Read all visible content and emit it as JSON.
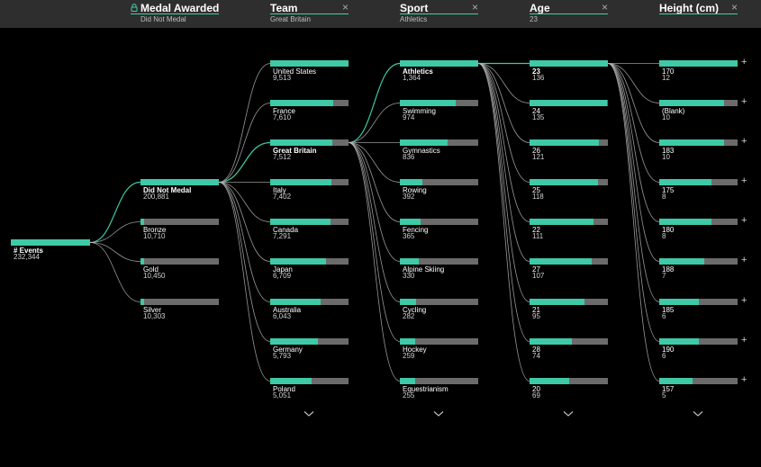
{
  "header": {
    "columns": [
      {
        "title": "Medal Awarded",
        "filter": "Did Not Medal",
        "close": "",
        "locked": true
      },
      {
        "title": "Team",
        "filter": "Great Britain",
        "close": "×",
        "locked": false
      },
      {
        "title": "Sport",
        "filter": "Athletics",
        "close": "×",
        "locked": false
      },
      {
        "title": "Age",
        "filter": "23",
        "close": "×",
        "locked": false
      },
      {
        "title": "Height (cm)",
        "filter": "",
        "close": "×",
        "locked": false
      }
    ]
  },
  "root": {
    "label": "# Events",
    "value": "232,344"
  },
  "levels": [
    {
      "name": "Medal Awarded",
      "nodes": [
        {
          "label": "Did Not Medal",
          "value": "200,881",
          "fill": 1.0,
          "selected": true
        },
        {
          "label": "Bronze",
          "value": "10,710",
          "fill": 0.05,
          "selected": false
        },
        {
          "label": "Gold",
          "value": "10,450",
          "fill": 0.05,
          "selected": false
        },
        {
          "label": "Silver",
          "value": "10,303",
          "fill": 0.05,
          "selected": false
        }
      ]
    },
    {
      "name": "Team",
      "nodes": [
        {
          "label": "United States",
          "value": "9,513",
          "fill": 1.0,
          "selected": false
        },
        {
          "label": "France",
          "value": "7,610",
          "fill": 0.8,
          "selected": false
        },
        {
          "label": "Great Britain",
          "value": "7,512",
          "fill": 0.79,
          "selected": true
        },
        {
          "label": "Italy",
          "value": "7,402",
          "fill": 0.78,
          "selected": false
        },
        {
          "label": "Canada",
          "value": "7,291",
          "fill": 0.77,
          "selected": false
        },
        {
          "label": "Japan",
          "value": "6,709",
          "fill": 0.71,
          "selected": false
        },
        {
          "label": "Australia",
          "value": "6,043",
          "fill": 0.64,
          "selected": false
        },
        {
          "label": "Germany",
          "value": "5,793",
          "fill": 0.61,
          "selected": false
        },
        {
          "label": "Poland",
          "value": "5,051",
          "fill": 0.53,
          "selected": false
        }
      ]
    },
    {
      "name": "Sport",
      "nodes": [
        {
          "label": "Athletics",
          "value": "1,364",
          "fill": 1.0,
          "selected": true
        },
        {
          "label": "Swimming",
          "value": "974",
          "fill": 0.71,
          "selected": false
        },
        {
          "label": "Gymnastics",
          "value": "836",
          "fill": 0.61,
          "selected": false
        },
        {
          "label": "Rowing",
          "value": "392",
          "fill": 0.29,
          "selected": false
        },
        {
          "label": "Fencing",
          "value": "365",
          "fill": 0.27,
          "selected": false
        },
        {
          "label": "Alpine Skiing",
          "value": "330",
          "fill": 0.24,
          "selected": false
        },
        {
          "label": "Cycling",
          "value": "282",
          "fill": 0.21,
          "selected": false
        },
        {
          "label": "Hockey",
          "value": "259",
          "fill": 0.19,
          "selected": false
        },
        {
          "label": "Equestrianism",
          "value": "255",
          "fill": 0.19,
          "selected": false
        }
      ]
    },
    {
      "name": "Age",
      "nodes": [
        {
          "label": "23",
          "value": "136",
          "fill": 1.0,
          "selected": true
        },
        {
          "label": "24",
          "value": "135",
          "fill": 0.99,
          "selected": false
        },
        {
          "label": "26",
          "value": "121",
          "fill": 0.89,
          "selected": false
        },
        {
          "label": "25",
          "value": "118",
          "fill": 0.87,
          "selected": false
        },
        {
          "label": "22",
          "value": "111",
          "fill": 0.82,
          "selected": false
        },
        {
          "label": "27",
          "value": "107",
          "fill": 0.79,
          "selected": false
        },
        {
          "label": "21",
          "value": "95",
          "fill": 0.7,
          "selected": false
        },
        {
          "label": "28",
          "value": "74",
          "fill": 0.54,
          "selected": false
        },
        {
          "label": "20",
          "value": "69",
          "fill": 0.51,
          "selected": false
        }
      ]
    },
    {
      "name": "Height (cm)",
      "nodes": [
        {
          "label": "170",
          "value": "12",
          "fill": 1.0,
          "selected": false
        },
        {
          "label": "(Blank)",
          "value": "10",
          "fill": 0.83,
          "selected": false
        },
        {
          "label": "183",
          "value": "10",
          "fill": 0.83,
          "selected": false
        },
        {
          "label": "175",
          "value": "8",
          "fill": 0.67,
          "selected": false
        },
        {
          "label": "180",
          "value": "8",
          "fill": 0.67,
          "selected": false
        },
        {
          "label": "188",
          "value": "7",
          "fill": 0.58,
          "selected": false
        },
        {
          "label": "185",
          "value": "6",
          "fill": 0.5,
          "selected": false
        },
        {
          "label": "190",
          "value": "6",
          "fill": 0.5,
          "selected": false
        },
        {
          "label": "157",
          "value": "5",
          "fill": 0.42,
          "selected": false
        }
      ]
    }
  ],
  "expand_symbol": "+",
  "colors": {
    "accent": "#3ec9a7",
    "track": "#6b6b6b",
    "link": "#bdbdbd",
    "header_bg": "#2e2e2e"
  }
}
